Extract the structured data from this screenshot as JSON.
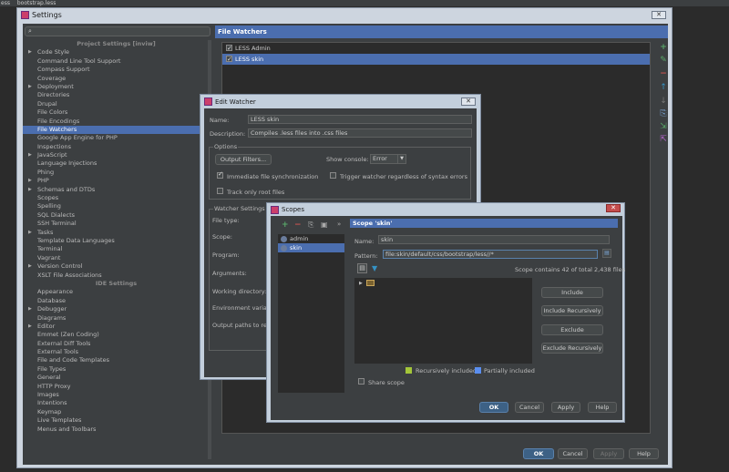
{
  "topbar": {
    "tab1": "ess",
    "tab2": "bootstrap.less"
  },
  "settings": {
    "title": "Settings",
    "close": "✕",
    "search_placeholder": "",
    "tree": [
      {
        "label": "Project Settings [inviw]",
        "header": true
      },
      {
        "label": "Code Style",
        "arrow": true
      },
      {
        "label": "Command Line Tool Support"
      },
      {
        "label": "Compass Support"
      },
      {
        "label": "Coverage"
      },
      {
        "label": "Deployment",
        "arrow": true
      },
      {
        "label": "Directories"
      },
      {
        "label": "Drupal"
      },
      {
        "label": "File Colors"
      },
      {
        "label": "File Encodings"
      },
      {
        "label": "File Watchers",
        "selected": true
      },
      {
        "label": "Google App Engine for PHP"
      },
      {
        "label": "Inspections"
      },
      {
        "label": "JavaScript",
        "arrow": true
      },
      {
        "label": "Language Injections"
      },
      {
        "label": "Phing"
      },
      {
        "label": "PHP",
        "arrow": true
      },
      {
        "label": "Schemas and DTDs",
        "arrow": true
      },
      {
        "label": "Scopes"
      },
      {
        "label": "Spelling"
      },
      {
        "label": "SQL Dialects"
      },
      {
        "label": "SSH Terminal"
      },
      {
        "label": "Tasks",
        "arrow": true
      },
      {
        "label": "Template Data Languages"
      },
      {
        "label": "Terminal"
      },
      {
        "label": "Vagrant"
      },
      {
        "label": "Version Control",
        "arrow": true
      },
      {
        "label": "XSLT File Associations"
      },
      {
        "label": "IDE Settings",
        "header": true
      },
      {
        "label": "Appearance"
      },
      {
        "label": "Database"
      },
      {
        "label": "Debugger",
        "arrow": true
      },
      {
        "label": "Diagrams"
      },
      {
        "label": "Editor",
        "arrow": true
      },
      {
        "label": "Emmet (Zen Coding)"
      },
      {
        "label": "External Diff Tools"
      },
      {
        "label": "External Tools"
      },
      {
        "label": "File and Code Templates"
      },
      {
        "label": "File Types"
      },
      {
        "label": "General"
      },
      {
        "label": "HTTP Proxy"
      },
      {
        "label": "Images"
      },
      {
        "label": "Intentions"
      },
      {
        "label": "Keymap"
      },
      {
        "label": "Live Templates"
      },
      {
        "label": "Menus and Toolbars"
      }
    ],
    "panel_title": "File Watchers",
    "watchers": [
      {
        "label": "LESS Admin",
        "checked": true,
        "selected": false
      },
      {
        "label": "LESS skin",
        "checked": true,
        "selected": true
      }
    ],
    "buttons": {
      "ok": "OK",
      "cancel": "Cancel",
      "apply": "Apply",
      "help": "Help"
    }
  },
  "edit_watcher": {
    "title": "Edit Watcher",
    "close": "✕",
    "name_label": "Name:",
    "name_value": "LESS skin",
    "description_label": "Description:",
    "description_value": "Compiles .less files into .css files",
    "options_label": "Options",
    "output_filters": "Output Filters...",
    "show_console_label": "Show console:",
    "show_console_value": "Error",
    "immediate_sync": "Immediate file synchronization",
    "trigger_watcher": "Trigger watcher regardless of syntax errors",
    "track_root": "Track only root files",
    "watcher_settings_label": "Watcher Settings",
    "file_type": "File type:",
    "scope": "Scope:",
    "program": "Program:",
    "arguments": "Arguments:",
    "working_dir": "Working directory:",
    "env_vars": "Environment variabl",
    "output_paths": "Output paths to refre"
  },
  "scopes": {
    "title": "Scopes",
    "close": "✕",
    "items": [
      {
        "label": "admin"
      },
      {
        "label": "skin",
        "selected": true
      }
    ],
    "scope_title": "Scope 'skin'",
    "name_label": "Name:",
    "name_value": "skin",
    "pattern_label": "Pattern:",
    "pattern_value": "file:skin/default/css/bootstrap/less//*",
    "contains": "Scope contains 42 of total 2,438 files",
    "include": "Include",
    "include_rec": "Include Recursively",
    "exclude": "Exclude",
    "exclude_rec": "Exclude Recursively",
    "legend_rec": "Recursively included",
    "legend_part": "Partially included",
    "share": "Share scope",
    "buttons": {
      "ok": "OK",
      "cancel": "Cancel",
      "apply": "Apply",
      "help": "Help"
    }
  },
  "colors": {
    "selection": "#4b6eaf",
    "legend_recursive": "#a4c639",
    "legend_partial": "#5a8ef0"
  }
}
